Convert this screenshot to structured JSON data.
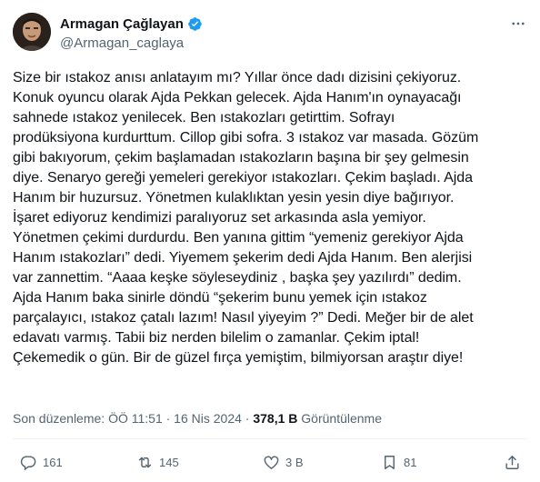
{
  "author": {
    "name": "Armagan Çağlayan",
    "handle": "@Armagan_caglaya",
    "verified_color": "#1d9bf0"
  },
  "icons": {
    "more": "more-dots-icon",
    "verified": "verified-badge-icon",
    "reply": "reply-icon",
    "retweet": "retweet-icon",
    "like": "like-icon",
    "bookmark": "bookmark-icon",
    "share": "share-icon"
  },
  "tweet": {
    "lines": [
      "Size bir ıstakoz anısı anlatayım mı? Yıllar önce dadı dizisini çekiyoruz.",
      "Konuk oyuncu olarak Ajda Pekkan gelecek. Ajda Hanım'ın oynayacağı",
      "sahnede ıstakoz yenilecek. Ben ıstakozları getirttim. Sofrayı",
      "prodüksiyona kurdurttum. Cillop gibi sofra. 3 ıstakoz var masada. Gözüm",
      "gibi bakıyorum, çekim başlamadan ıstakozların başına bir şey gelmesin",
      "diye. Senaryo gereği yemeleri gerekiyor ıstakozları. Çekim başladı. Ajda",
      "Hanım bir huzursuz. Yönetmen kulaklıktan yesin yesin diye bağırıyor.",
      "İşaret ediyoruz kendimizi paralıyoruz set arkasında asla yemiyor.",
      "Yönetmen çekimi durdurdu. Ben yanına gittim “yemeniz gerekiyor Ajda",
      "Hanım ıstakozları” dedi. Yiyemem şekerim dedi Ajda Hanım. Ben alerjisi",
      "var zannettim. “Aaaa keşke söyleseydiniz , başka şey yazılırdı” dedim.",
      "Ajda Hanım baka sinirle döndü “şekerim bunu yemek için ıstakoz",
      "parçalayıcı, ıstakoz çatalı lazım! Nasıl yiyeyim ?” Dedi. Meğer bir de alet",
      "edavatı varmış. Tabii biz nerden bilelim o zamanlar. Çekim iptal!",
      "Çekemedik o gün. Bir de güzel fırça yemiştim, bilmiyorsan araştır diye!"
    ]
  },
  "meta": {
    "edited_label": "Son düzenleme: ÖÖ 11:51 · 16 Nis 2024 · ",
    "views_count": "378,1 B",
    "views_label": " Görüntülenme"
  },
  "actions": {
    "reply_count": "161",
    "retweet_count": "145",
    "like_count": "3 B",
    "bookmark_count": "81"
  }
}
